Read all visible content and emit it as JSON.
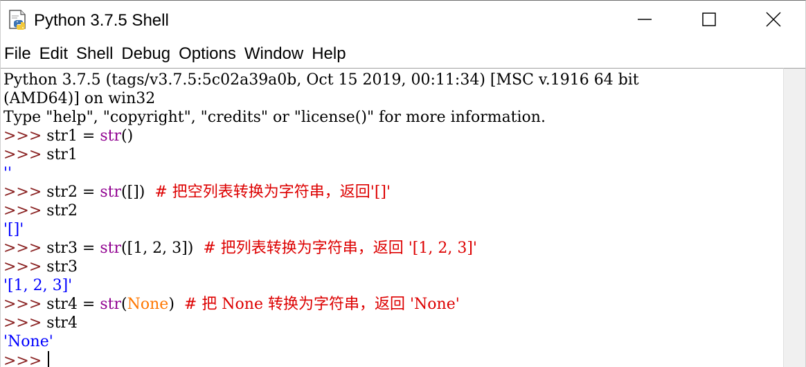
{
  "window": {
    "title": "Python 3.7.5 Shell"
  },
  "icons": {
    "app": "python-idle-icon",
    "minimize": "minimize-icon",
    "maximize": "maximize-icon",
    "close": "close-icon"
  },
  "menu": {
    "items": [
      "File",
      "Edit",
      "Shell",
      "Debug",
      "Options",
      "Window",
      "Help"
    ]
  },
  "colors": {
    "prompt": "#8a2222",
    "builtin": "#900090",
    "comment": "#dd0000",
    "string": "#00aa00",
    "output": "#0000ff",
    "keyword": "#ff7700",
    "default": "#000000"
  },
  "shell": {
    "lines": [
      [
        {
          "t": "Python 3.7.5 (tags/v3.7.5:5c02a39a0b, Oct 15 2019, 00:11:34) [MSC v.1916 64 bit",
          "c": "default"
        }
      ],
      [
        {
          "t": "(AMD64)] on win32",
          "c": "default"
        }
      ],
      [
        {
          "t": "Type \"help\", \"copyright\", \"credits\" or \"license()\" for more information.",
          "c": "default"
        }
      ],
      [
        {
          "t": ">>> ",
          "c": "prompt"
        },
        {
          "t": "str1 = ",
          "c": "default"
        },
        {
          "t": "str",
          "c": "builtin"
        },
        {
          "t": "()",
          "c": "default"
        }
      ],
      [
        {
          "t": ">>> ",
          "c": "prompt"
        },
        {
          "t": "str1",
          "c": "default"
        }
      ],
      [
        {
          "t": "''",
          "c": "output"
        }
      ],
      [
        {
          "t": ">>> ",
          "c": "prompt"
        },
        {
          "t": "str2 = ",
          "c": "default"
        },
        {
          "t": "str",
          "c": "builtin"
        },
        {
          "t": "([])  ",
          "c": "default"
        },
        {
          "t": "# 把空列表转换为字符串，返回'[]'",
          "c": "comment"
        }
      ],
      [
        {
          "t": ">>> ",
          "c": "prompt"
        },
        {
          "t": "str2",
          "c": "default"
        }
      ],
      [
        {
          "t": "'[]'",
          "c": "output"
        }
      ],
      [
        {
          "t": ">>> ",
          "c": "prompt"
        },
        {
          "t": "str3 = ",
          "c": "default"
        },
        {
          "t": "str",
          "c": "builtin"
        },
        {
          "t": "([1, 2, 3])  ",
          "c": "default"
        },
        {
          "t": "# 把列表转换为字符串，返回 '[1, 2, 3]'",
          "c": "comment"
        }
      ],
      [
        {
          "t": ">>> ",
          "c": "prompt"
        },
        {
          "t": "str3",
          "c": "default"
        }
      ],
      [
        {
          "t": "'[1, 2, 3]'",
          "c": "output"
        }
      ],
      [
        {
          "t": ">>> ",
          "c": "prompt"
        },
        {
          "t": "str4 = ",
          "c": "default"
        },
        {
          "t": "str",
          "c": "builtin"
        },
        {
          "t": "(",
          "c": "default"
        },
        {
          "t": "None",
          "c": "keyword"
        },
        {
          "t": ")  ",
          "c": "default"
        },
        {
          "t": "# 把 None 转换为字符串，返回 'None'",
          "c": "comment"
        }
      ],
      [
        {
          "t": ">>> ",
          "c": "prompt"
        },
        {
          "t": "str4",
          "c": "default"
        }
      ],
      [
        {
          "t": "'None'",
          "c": "output"
        }
      ],
      [
        {
          "t": ">>> ",
          "c": "prompt"
        }
      ]
    ]
  }
}
